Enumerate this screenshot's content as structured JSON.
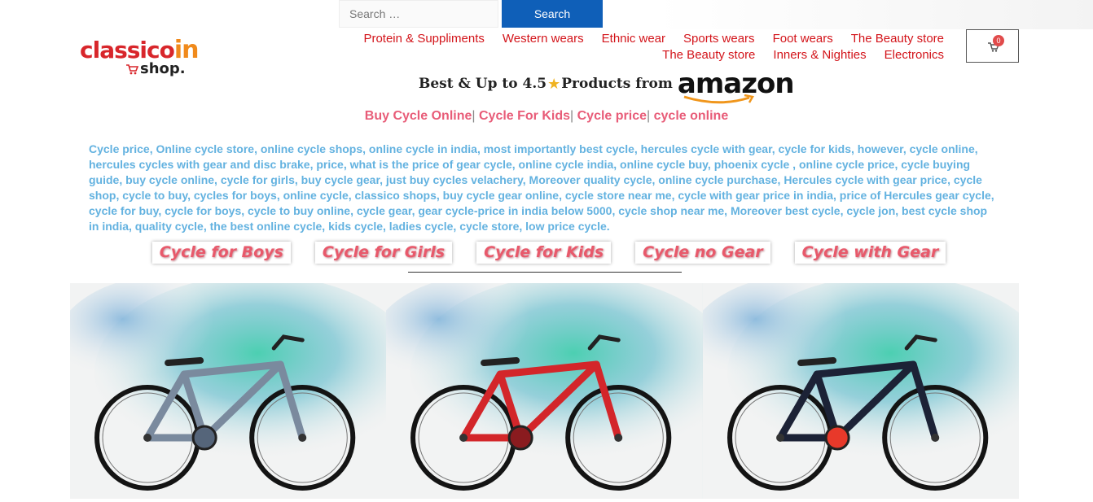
{
  "search": {
    "placeholder": "Search …",
    "button_label": "Search"
  },
  "logo": {
    "main": "classico",
    "suffix": "in",
    "sub": "shop."
  },
  "nav": {
    "row1": [
      "Protein & Suppliments",
      "Western wears",
      "Ethnic wear",
      "Sports wears",
      "Foot wears",
      "The Beauty store"
    ],
    "row2": [
      "The Beauty store",
      "Inners & Nighties",
      "Electronics"
    ]
  },
  "cart": {
    "count": "0",
    "icon": "cart-icon"
  },
  "amazon_banner": {
    "text_before": "Best & Up to 4.5",
    "star": "★",
    "text_after": "Products from",
    "brand": "amazon"
  },
  "quick_links": [
    {
      "label": "Buy Cycle Online"
    },
    {
      "label": "Cycle For Kids"
    },
    {
      "label": "Cycle price"
    },
    {
      "label": "cycle online"
    }
  ],
  "quick_links_separator": "|",
  "keywords": "Cycle price, Online cycle store, online cycle shops, online cycle in india, most importantly best cycle, hercules cycle with gear, cycle for kids, however, cycle online, hercules cycles with gear and disc brake, price, what is the price of gear cycle, online cycle india, online cycle buy, phoenix cycle , online cycle price, cycle buying guide, buy cycle online, cycle for girls, buy cycle gear, just buy cycles velachery, Moreover quality cycle, online cycle purchase, Hercules cycle with gear price, cycle shop, cycle to buy, cycles for boys, online cycle, classico shops, buy cycle gear online, cycle store near me, cycle with gear price in india, price of Hercules gear cycle, cycle for buy, cycle for boys, cycle to buy online, cycle gear, gear cycle-price in india below 5000, cycle shop near me, Moreover best cycle, cycle jon, best cycle shop in india, quality cycle, the best online cycle, kids cycle, ladies cycle, cycle store, low price cycle.",
  "category_buttons": [
    "Cycle for Boys",
    "Cycle for Girls",
    "Cycle for Kids",
    "Cycle no Gear",
    "Cycle with Gear"
  ],
  "products": [
    {
      "frame_color": "#7a8a9e",
      "accent": "#55657a"
    },
    {
      "frame_color": "#d3262a",
      "accent": "#8a1b1f"
    },
    {
      "frame_color": "#1c2236",
      "accent": "#e8392a"
    }
  ],
  "colors": {
    "nav_red": "#d3141a",
    "link_pink": "#e85c78",
    "keyword_blue": "#63b2e0",
    "search_blue": "#0f5fb8"
  }
}
